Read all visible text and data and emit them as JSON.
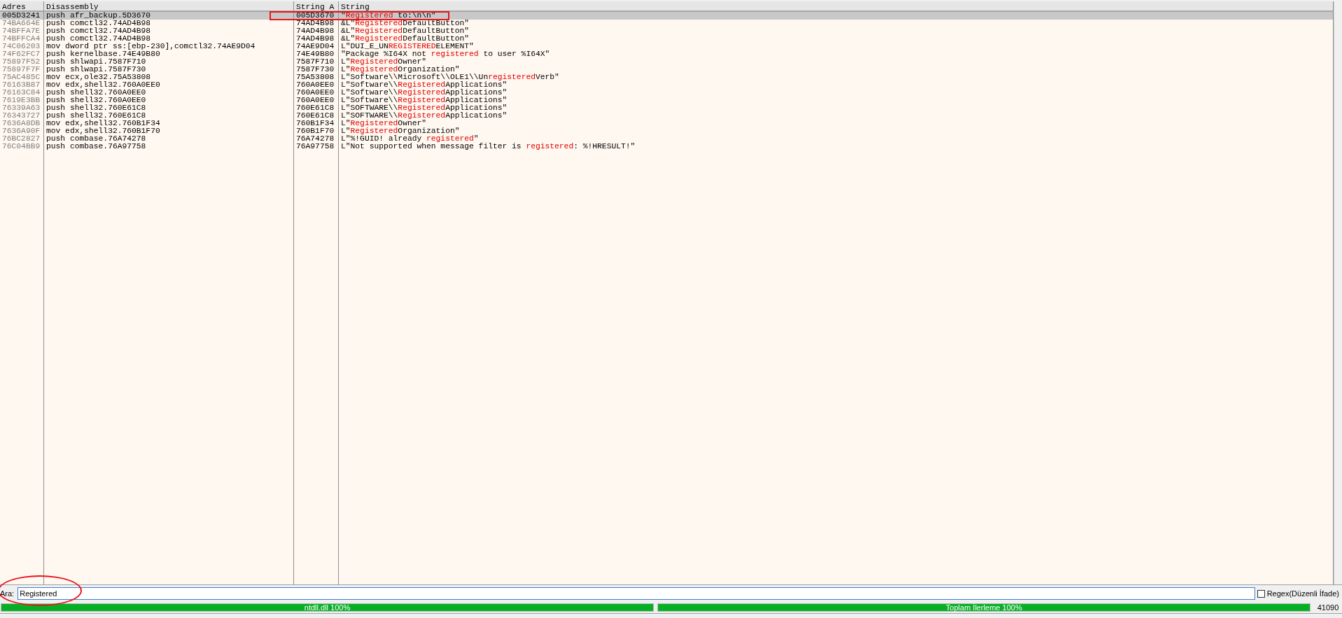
{
  "table": {
    "columns": [
      "Adres",
      "Disassembly",
      "String A",
      "String"
    ],
    "rows": [
      {
        "address": "005D3241",
        "disassembly": "push afr_backup.5D3670",
        "string_address": "005D3670",
        "string": [
          {
            "text": "\"",
            "match": false
          },
          {
            "text": "Registered",
            "match": true
          },
          {
            "text": " to:\\n\\n\"",
            "match": false
          }
        ],
        "selected": true
      },
      {
        "address": "74BA664E",
        "disassembly": "push comctl32.74AD4B98",
        "string_address": "74AD4B98",
        "string": [
          {
            "text": "&L\"",
            "match": false
          },
          {
            "text": "Registered",
            "match": true
          },
          {
            "text": "DefaultButton\"",
            "match": false
          }
        ],
        "selected": false
      },
      {
        "address": "74BFFA7E",
        "disassembly": "push comctl32.74AD4B98",
        "string_address": "74AD4B98",
        "string": [
          {
            "text": "&L\"",
            "match": false
          },
          {
            "text": "Registered",
            "match": true
          },
          {
            "text": "DefaultButton\"",
            "match": false
          }
        ],
        "selected": false
      },
      {
        "address": "74BFFCA4",
        "disassembly": "push comctl32.74AD4B98",
        "string_address": "74AD4B98",
        "string": [
          {
            "text": "&L\"",
            "match": false
          },
          {
            "text": "Registered",
            "match": true
          },
          {
            "text": "DefaultButton\"",
            "match": false
          }
        ],
        "selected": false
      },
      {
        "address": "74C06203",
        "disassembly": "mov dword ptr ss:[ebp-230],comctl32.74AE9D04",
        "string_address": "74AE9D04",
        "string": [
          {
            "text": "L\"DUI_E_UN",
            "match": false
          },
          {
            "text": "REGISTERED",
            "match": true
          },
          {
            "text": "ELEMENT\"",
            "match": false
          }
        ],
        "selected": false
      },
      {
        "address": "74F62FC7",
        "disassembly": "push kernelbase.74E49B80",
        "string_address": "74E49B80",
        "string": [
          {
            "text": "\"Package %I64X not ",
            "match": false
          },
          {
            "text": "registered",
            "match": true
          },
          {
            "text": " to user %I64X\"",
            "match": false
          }
        ],
        "selected": false
      },
      {
        "address": "75897F52",
        "disassembly": "push shlwapi.7587F710",
        "string_address": "7587F710",
        "string": [
          {
            "text": "L\"",
            "match": false
          },
          {
            "text": "Registered",
            "match": true
          },
          {
            "text": "Owner\"",
            "match": false
          }
        ],
        "selected": false
      },
      {
        "address": "75897F7F",
        "disassembly": "push shlwapi.7587F730",
        "string_address": "7587F730",
        "string": [
          {
            "text": "L\"",
            "match": false
          },
          {
            "text": "Registered",
            "match": true
          },
          {
            "text": "Organization\"",
            "match": false
          }
        ],
        "selected": false
      },
      {
        "address": "75AC485C",
        "disassembly": "mov ecx,ole32.75A53808",
        "string_address": "75A53808",
        "string": [
          {
            "text": "L\"Software\\\\Microsoft\\\\OLE1\\\\Un",
            "match": false
          },
          {
            "text": "registered",
            "match": true
          },
          {
            "text": "Verb\"",
            "match": false
          }
        ],
        "selected": false
      },
      {
        "address": "76163B87",
        "disassembly": "mov edx,shell32.760A0EE0",
        "string_address": "760A0EE0",
        "string": [
          {
            "text": "L\"Software\\\\",
            "match": false
          },
          {
            "text": "Registered",
            "match": true
          },
          {
            "text": "Applications\"",
            "match": false
          }
        ],
        "selected": false
      },
      {
        "address": "76163C84",
        "disassembly": "push shell32.760A0EE0",
        "string_address": "760A0EE0",
        "string": [
          {
            "text": "L\"Software\\\\",
            "match": false
          },
          {
            "text": "Registered",
            "match": true
          },
          {
            "text": "Applications\"",
            "match": false
          }
        ],
        "selected": false
      },
      {
        "address": "7619E3BB",
        "disassembly": "push shell32.760A0EE0",
        "string_address": "760A0EE0",
        "string": [
          {
            "text": "L\"Software\\\\",
            "match": false
          },
          {
            "text": "Registered",
            "match": true
          },
          {
            "text": "Applications\"",
            "match": false
          }
        ],
        "selected": false
      },
      {
        "address": "76339A63",
        "disassembly": "push shell32.760E61C8",
        "string_address": "760E61C8",
        "string": [
          {
            "text": "L\"SOFTWARE\\\\",
            "match": false
          },
          {
            "text": "Registered",
            "match": true
          },
          {
            "text": "Applications\"",
            "match": false
          }
        ],
        "selected": false
      },
      {
        "address": "76343727",
        "disassembly": "push shell32.760E61C8",
        "string_address": "760E61C8",
        "string": [
          {
            "text": "L\"SOFTWARE\\\\",
            "match": false
          },
          {
            "text": "Registered",
            "match": true
          },
          {
            "text": "Applications\"",
            "match": false
          }
        ],
        "selected": false
      },
      {
        "address": "7636A8DB",
        "disassembly": "mov edx,shell32.760B1F34",
        "string_address": "760B1F34",
        "string": [
          {
            "text": "L\"",
            "match": false
          },
          {
            "text": "Registered",
            "match": true
          },
          {
            "text": "Owner\"",
            "match": false
          }
        ],
        "selected": false
      },
      {
        "address": "7636A90F",
        "disassembly": "mov edx,shell32.760B1F70",
        "string_address": "760B1F70",
        "string": [
          {
            "text": "L\"",
            "match": false
          },
          {
            "text": "Registered",
            "match": true
          },
          {
            "text": "Organization\"",
            "match": false
          }
        ],
        "selected": false
      },
      {
        "address": "76BC2827",
        "disassembly": "push combase.76A74278",
        "string_address": "76A74278",
        "string": [
          {
            "text": "L\"%!GUID! already ",
            "match": false
          },
          {
            "text": "registered",
            "match": true
          },
          {
            "text": "\"",
            "match": false
          }
        ],
        "selected": false
      },
      {
        "address": "76C04BB9",
        "disassembly": "push combase.76A97758",
        "string_address": "76A97758",
        "string": [
          {
            "text": "L\"Not supported when message filter is ",
            "match": false
          },
          {
            "text": "registered",
            "match": true
          },
          {
            "text": ": %!HRESULT!\"",
            "match": false
          }
        ],
        "selected": false
      }
    ]
  },
  "search": {
    "label": "Ara:",
    "value": "Registered",
    "regex": {
      "label": "Regex(Düzenli İfade)",
      "checked": false
    }
  },
  "progress": [
    {
      "label": "ntdll.dll 100%",
      "level": 1
    },
    {
      "label": "Toplam İlerleme 100%",
      "level": 1
    }
  ],
  "count": "41090",
  "annotations": [
    {
      "kind": "rectangle"
    },
    {
      "kind": "ellipse"
    }
  ]
}
